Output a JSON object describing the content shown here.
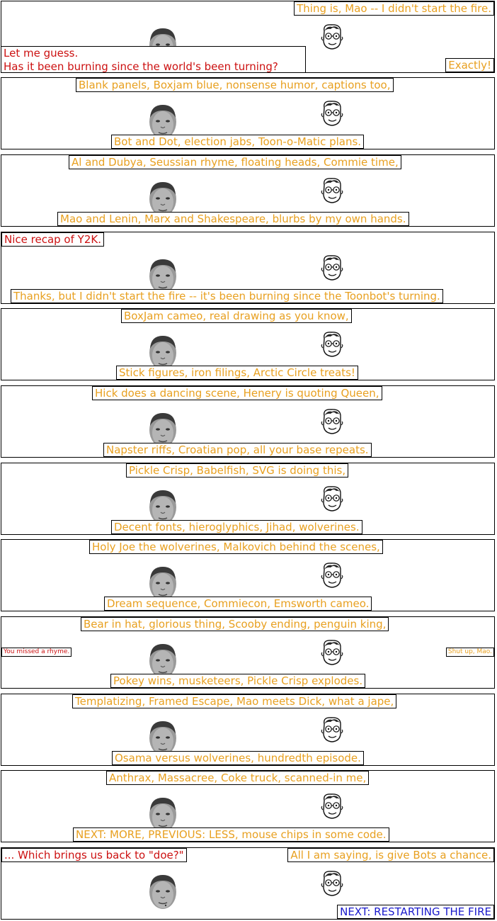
{
  "panels": [
    {
      "captions": [
        {
          "text": "Thing is, Mao -- I didn't start the fire."
        },
        {
          "text": "Let me guess."
        },
        {
          "text": "Has it been burning since the world's been turning?"
        },
        {
          "text": "Exactly!"
        }
      ]
    },
    {
      "captions": [
        {
          "text": "Blank panels, Boxjam blue, nonsense humor, captions too,"
        },
        {
          "text": "Bot and Dot, election jabs, Toon-o-Matic plans."
        }
      ]
    },
    {
      "captions": [
        {
          "text": "Al and Dubya, Seussian rhyme, floating heads, Commie time,"
        },
        {
          "text": "Mao and Lenin, Marx and Shakespeare, blurbs by my own hands."
        }
      ]
    },
    {
      "captions": [
        {
          "text": "Nice recap of Y2K."
        },
        {
          "text": "Thanks, but I didn't start the fire -- it's been burning since the Toonbot's turning."
        }
      ]
    },
    {
      "captions": [
        {
          "text": "BoxJam cameo, real drawing as you know,"
        },
        {
          "text": "Stick figures, iron filings, Arctic Circle treats!"
        }
      ]
    },
    {
      "captions": [
        {
          "text": "Hick does a dancing scene, Henery is quoting Queen,"
        },
        {
          "text": "Napster riffs, Croatian pop, all your base repeats."
        }
      ]
    },
    {
      "captions": [
        {
          "text": "Pickle Crisp, Babelfish, SVG is doing this,"
        },
        {
          "text": "Decent fonts, hieroglyphics, Jihad, wolverines."
        }
      ]
    },
    {
      "captions": [
        {
          "text": "Holy Joe the wolverines, Malkovich behind the scenes,"
        },
        {
          "text": "Dream sequence, Commiecon, Emsworth cameo."
        }
      ]
    },
    {
      "captions": [
        {
          "text": "Bear in hat, glorious thing, Scooby ending, penguin king,"
        },
        {
          "text": "You missed a rhyme."
        },
        {
          "text": "Shut up, Mao."
        },
        {
          "text": "Pokey wins, musketeers, Pickle Crisp explodes."
        }
      ]
    },
    {
      "captions": [
        {
          "text": "Templatizing, Framed Escape, Mao meets Dick, what a jape,"
        },
        {
          "text": "Osama versus wolverines, hundredth episode."
        }
      ]
    },
    {
      "captions": [
        {
          "text": "Anthrax, Massacree, Coke truck, scanned-in me,"
        },
        {
          "text": "NEXT: MORE, PREVIOUS: LESS, mouse chips in some code."
        }
      ]
    },
    {
      "captions": [
        {
          "text": "... Which brings us back to \"doe?\""
        },
        {
          "text": "All I am saying, is give Bots a chance."
        },
        {
          "text": "NEXT: RESTARTING THE FIRE"
        }
      ]
    }
  ],
  "colors": {
    "dot_caption": "#e8a020",
    "mao_caption": "#cc1111",
    "link": "#1a1acc"
  },
  "characters": {
    "left": "mao-head",
    "right": "dot-head"
  }
}
